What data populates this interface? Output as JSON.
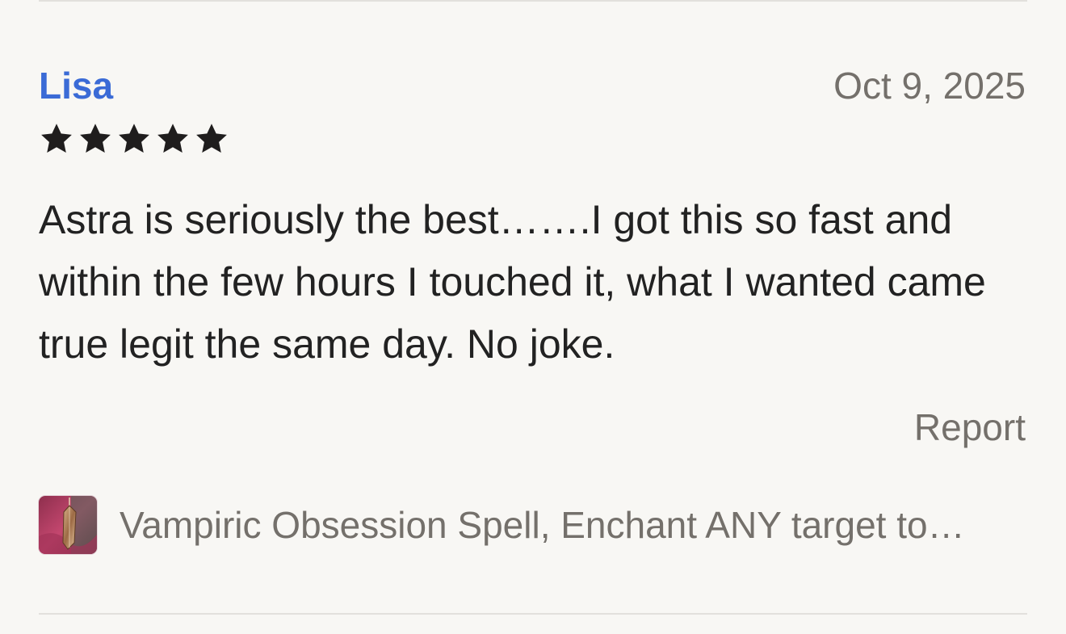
{
  "review": {
    "reviewer_name": "Lisa",
    "date": "Oct 9, 2025",
    "rating": 5,
    "rating_max": 5,
    "text": "Astra is seriously the best…….I got this so fast and within the few hours I touched it, what I wanted came true legit the same day. No joke.",
    "report_label": "Report"
  },
  "product": {
    "title": "Vampiric Obsession Spell, Enchant ANY target to…",
    "thumbnail_icon": "crystal-pendant-thumbnail"
  },
  "colors": {
    "background": "#f8f7f4",
    "reviewer_link": "#3b6bd6",
    "muted_text": "#74706b",
    "body_text": "#222222",
    "star": "#1f1d1d",
    "divider": "#e2e0dc"
  }
}
